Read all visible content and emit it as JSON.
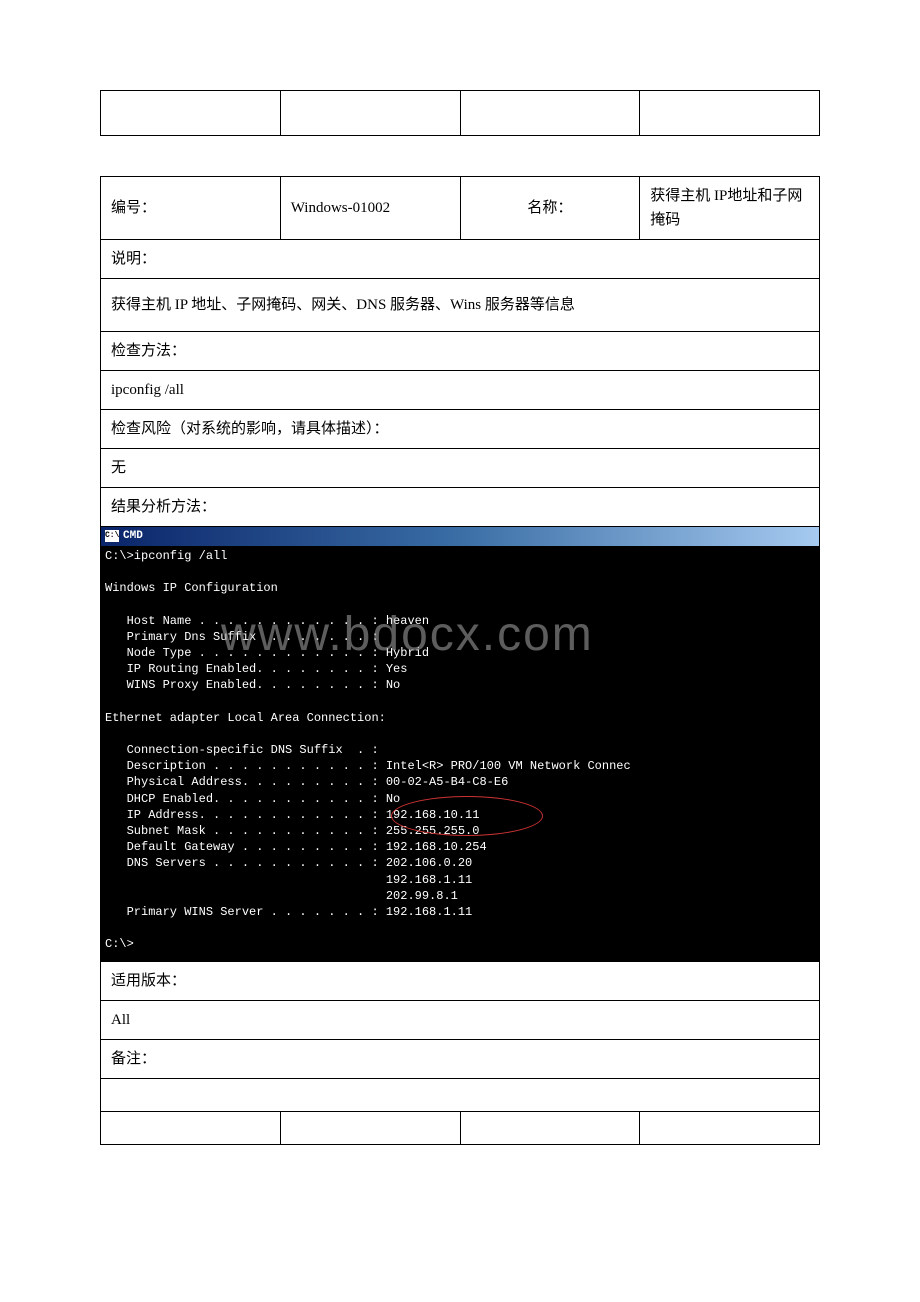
{
  "table1": {
    "col1": "",
    "col2": "",
    "col3": "",
    "col4": ""
  },
  "header": {
    "id_label": "编号：",
    "id_value": "Windows-01002",
    "name_label": "名称：",
    "name_value": "获得主机 IP地址和子网掩码"
  },
  "sections": {
    "desc_label": "说明：",
    "desc_body": "获得主机 IP 地址、子网掩码、网关、DNS 服务器、Wins 服务器等信息",
    "method_label": "检查方法：",
    "method_body": "ipconfig /all",
    "risk_label": "检查风险（对系统的影响，请具体描述）：",
    "risk_body": "无",
    "analysis_label": "结果分析方法：",
    "version_label": "适用版本：",
    "version_body": "All",
    "notes_label": "备注："
  },
  "cmd": {
    "title": "CMD",
    "icon": "C:\\",
    "lines": "C:\\>ipconfig /all\n\nWindows IP Configuration\n\n   Host Name . . . . . . . . . . . . : heaven\n   Primary Dns Suffix  . . . . . . . :\n   Node Type . . . . . . . . . . . . : Hybrid\n   IP Routing Enabled. . . . . . . . : Yes\n   WINS Proxy Enabled. . . . . . . . : No\n\nEthernet adapter Local Area Connection:\n\n   Connection-specific DNS Suffix  . :\n   Description . . . . . . . . . . . : Intel<R> PRO/100 VM Network Connec\n   Physical Address. . . . . . . . . : 00-02-A5-B4-C8-E6\n   DHCP Enabled. . . . . . . . . . . : No\n   IP Address. . . . . . . . . . . . : 192.168.10.11\n   Subnet Mask . . . . . . . . . . . : 255.255.255.0\n   Default Gateway . . . . . . . . . : 192.168.10.254\n   DNS Servers . . . . . . . . . . . : 202.106.0.20\n                                       192.168.1.11\n                                       202.99.8.1\n   Primary WINS Server . . . . . . . : 192.168.1.11\n\nC:\\>"
  },
  "watermark": "www.bdocx.com"
}
